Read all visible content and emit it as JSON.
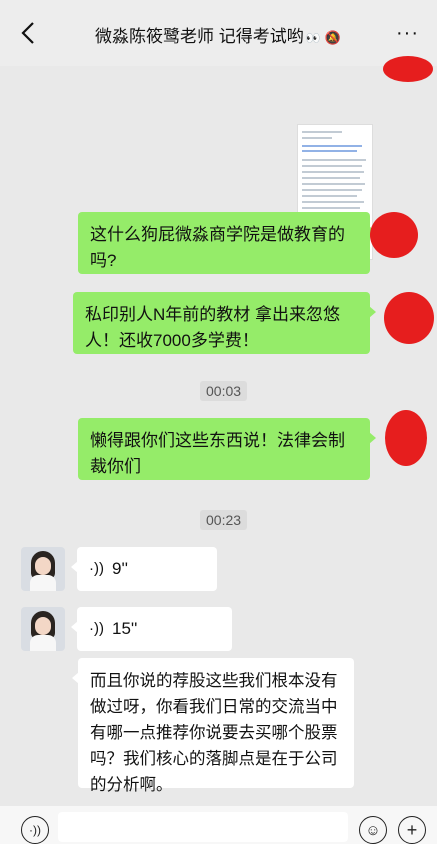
{
  "header": {
    "title": "微淼陈筱鹭老师 记得考试哟",
    "more_label": "···",
    "title_emoji": "👀"
  },
  "messages": [
    {
      "type": "image",
      "from": "me",
      "description": "文档截图"
    },
    {
      "type": "text",
      "from": "me",
      "text": "这什么狗屁微淼商学院是做教育的吗?"
    },
    {
      "type": "text",
      "from": "me",
      "text": "私印别人N年前的教材 拿出来忽悠人！还收7000多学费！"
    },
    {
      "type": "time",
      "text": "00:03"
    },
    {
      "type": "text",
      "from": "me",
      "text": "懒得跟你们这些东西说！法律会制裁你们"
    },
    {
      "type": "time",
      "text": "00:23"
    },
    {
      "type": "voice",
      "from": "other",
      "duration": "9''"
    },
    {
      "type": "voice",
      "from": "other",
      "duration": "15''"
    },
    {
      "type": "text",
      "from": "other",
      "text": "而且你说的荐股这些我们根本没有做过呀，你看我们日常的交流当中有哪一点推荐你说要去买哪个股票吗？我们核心的落脚点是在于公司的分析啊。"
    }
  ],
  "colors": {
    "my_bubble": "#95ec69",
    "their_bubble": "#ffffff",
    "chat_bg": "#e9e9e9",
    "redaction": "#e61e1e"
  },
  "input": {
    "voice_icon": "voice-icon",
    "emoji_icon": "emoji-icon",
    "plus_icon": "plus-icon"
  }
}
